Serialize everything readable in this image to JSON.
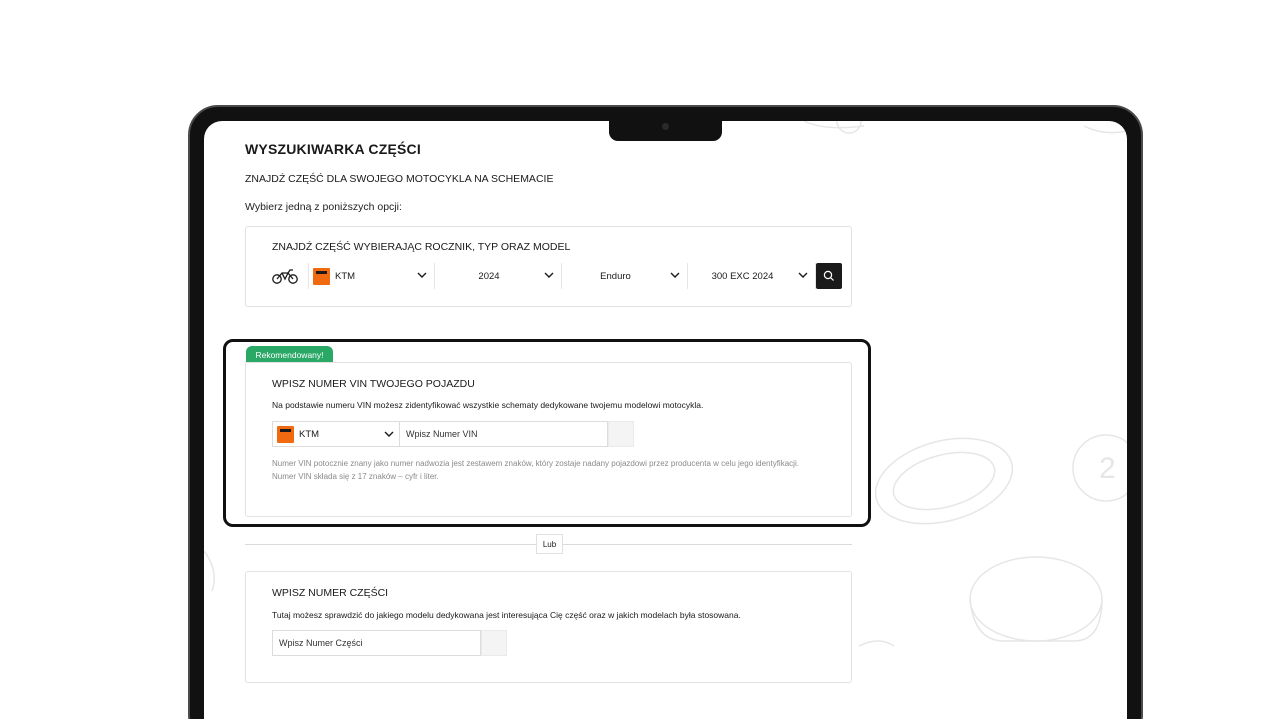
{
  "page": {
    "title": "WYSZUKIWARKA CZĘŚCI",
    "subtitle": "ZNAJDŹ CZĘŚĆ DLA SWOJEGO MOTOCYKLA NA SCHEMACIE",
    "instruction": "Wybierz jedną z poniższych opcji:"
  },
  "model_search": {
    "title": "ZNAJDŹ CZĘŚĆ WYBIERAJĄC ROCZNIK, TYP ORAZ MODEL",
    "brand": "KTM",
    "year": "2024",
    "type": "Enduro",
    "model": "300 EXC 2024"
  },
  "vin_search": {
    "badge": "Rekomendowany!",
    "title": "WPISZ NUMER VIN TWOJEGO POJAZDU",
    "description": "Na podstawie numeru VIN możesz zidentyfikować wszystkie schematy dedykowane twojemu modelowi motocykla.",
    "brand": "KTM",
    "input_placeholder": "Wpisz Numer VIN",
    "note": "Numer VIN potocznie znany jako numer nadwozia jest zestawem znaków, który zostaje nadany pojazdowi przez producenta w celu jego identyfikacji. Numer VIN składa się z 17 znaków – cyfr i liter."
  },
  "divider": {
    "label": "Lub"
  },
  "part_search": {
    "title": "WPISZ NUMER CZĘŚCI",
    "description": "Tutaj możesz sprawdzić do jakiego modelu dedykowana jest interesująca Cię część oraz w jakich modelach była stosowana.",
    "input_placeholder": "Wpisz Numer Części"
  },
  "colors": {
    "brand_orange": "#f26a10",
    "badge_green": "#2aa866",
    "search_button": "#1a1a1a"
  },
  "icons": [
    "motorcycle-icon",
    "chevron-down-icon",
    "search-icon",
    "ktm-logo"
  ]
}
